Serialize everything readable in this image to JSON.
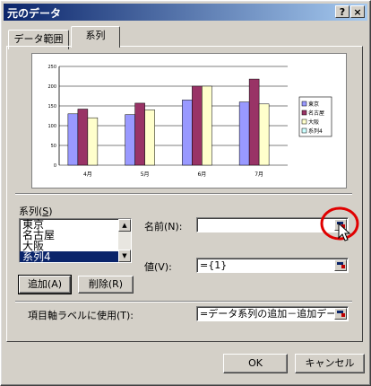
{
  "window": {
    "title": "元のデータ",
    "help_glyph": "?",
    "close_glyph": "×"
  },
  "tabs": [
    {
      "label": "データ範囲"
    },
    {
      "label": "系列"
    }
  ],
  "chart_data": {
    "type": "bar",
    "categories": [
      "4月",
      "5月",
      "6月",
      "7月"
    ],
    "series": [
      {
        "name": "東京",
        "values": [
          130,
          128,
          165,
          160
        ],
        "color": "#9999ff"
      },
      {
        "name": "名古屋",
        "values": [
          142,
          157,
          200,
          218
        ],
        "color": "#993366"
      },
      {
        "name": "大阪",
        "values": [
          120,
          140,
          200,
          155
        ],
        "color": "#ffffcc"
      },
      {
        "name": "系列4",
        "values": [
          0,
          0,
          0,
          0
        ],
        "color": "#ccffff"
      }
    ],
    "ylim": [
      0,
      250
    ],
    "yticks": [
      "0",
      "50",
      "100",
      "150",
      "200",
      "250"
    ],
    "legend": "right"
  },
  "series_section": {
    "label": "系列(",
    "label_key": "S",
    "label_end": ")",
    "items": [
      "東京",
      "名古屋",
      "大阪",
      "系列4"
    ],
    "selected_index": 3
  },
  "buttons": {
    "add": "追加(A)",
    "remove": "削除(R)",
    "ok": "OK",
    "cancel": "キャンセル"
  },
  "name_field": {
    "label": "名前(N):",
    "value": ""
  },
  "value_field": {
    "label": "値(V):",
    "value": "={1}"
  },
  "category_field": {
    "label": "項目軸ラベルに使用(T):",
    "value": "=データ系列の追加－追加デー"
  }
}
